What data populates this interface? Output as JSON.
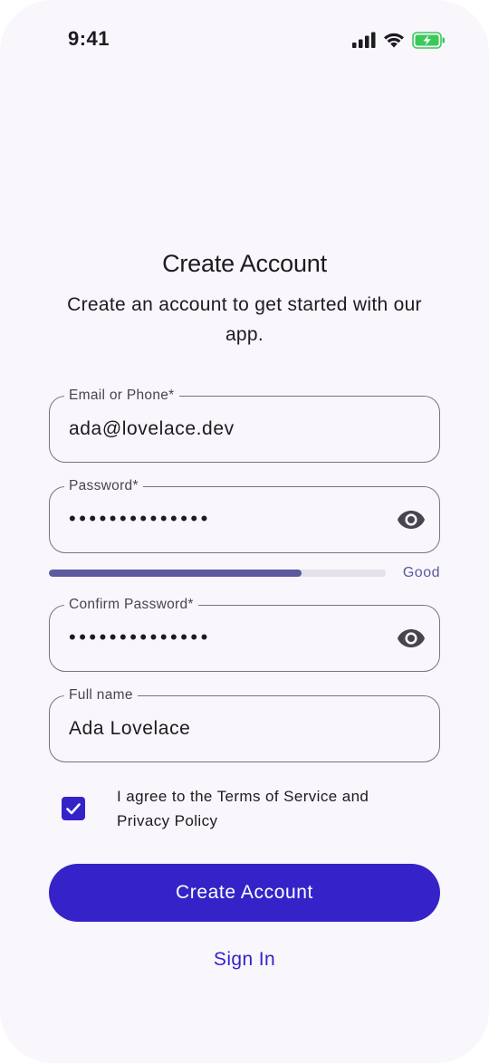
{
  "status_bar": {
    "time": "9:41",
    "signal_icon": "cellular-signal-icon",
    "wifi_icon": "wifi-icon",
    "battery_icon": "battery-charging-icon",
    "battery_color": "#3bc95b"
  },
  "header": {
    "title": "Create Account",
    "subtitle": "Create an account to get started with our app."
  },
  "form": {
    "email": {
      "label": "Email or Phone*",
      "value": "ada@lovelace.dev"
    },
    "password": {
      "label": "Password*",
      "value": "••••••••••••••",
      "toggle_icon": "eye-icon"
    },
    "strength": {
      "level": 0.75,
      "label": "Good",
      "color": "#5b59a0"
    },
    "confirm_password": {
      "label": "Confirm Password*",
      "value": "••••••••••••••",
      "toggle_icon": "eye-icon"
    },
    "full_name": {
      "label": "Full name",
      "value": "Ada Lovelace"
    },
    "terms": {
      "checked": true,
      "text": "I agree to the Terms of Service and Privacy Policy"
    }
  },
  "actions": {
    "create_label": "Create Account",
    "signin_label": "Sign In"
  },
  "colors": {
    "primary": "#3523c9",
    "background": "#f9f6fc",
    "outline": "#79747e"
  }
}
